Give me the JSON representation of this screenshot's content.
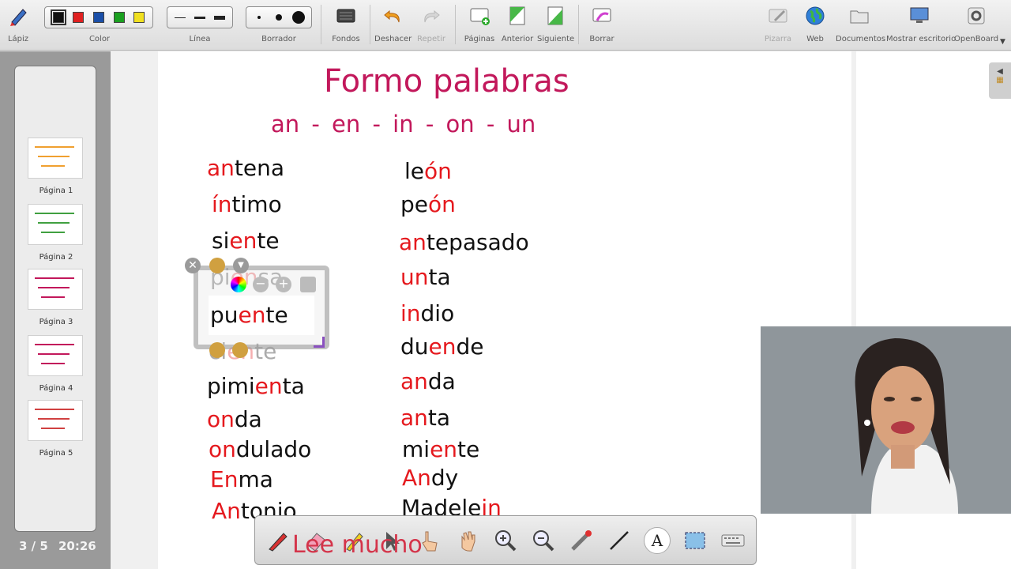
{
  "toolbar": {
    "pen_label": "Lápiz",
    "color_label": "Color",
    "line_label": "Línea",
    "eraser_label": "Borrador",
    "backgrounds_label": "Fondos",
    "undo_label": "Deshacer",
    "redo_label": "Repetir",
    "pages_label": "Páginas",
    "previous_label": "Anterior",
    "next_label": "Siguiente",
    "clear_label": "Borrar",
    "board_label": "Pizarra",
    "web_label": "Web",
    "documents_label": "Documentos",
    "desktop_label": "Mostrar escritorio",
    "app_label": "OpenBoard",
    "colors": [
      "#111111",
      "#e02020",
      "#1a4fa8",
      "#1aa020",
      "#f0e020"
    ]
  },
  "pages": {
    "thumbs": [
      {
        "label": "Página 1"
      },
      {
        "label": "Página 2"
      },
      {
        "label": "Página 3"
      },
      {
        "label": "Página 4"
      },
      {
        "label": "Página 5"
      }
    ],
    "counter": "3 / 5",
    "clock": "20:26"
  },
  "board": {
    "title": "Formo palabras",
    "syllables": "an - en - in - on  - un",
    "overlay_text": "Lee mucho",
    "left_words": [
      {
        "pre": "",
        "red": "an",
        "post": "tena"
      },
      {
        "pre": "",
        "red": "ín",
        "post": "timo"
      },
      {
        "pre": "si",
        "red": "en",
        "post": "te"
      },
      {
        "pre": "pi",
        "red": "en",
        "post": "sa"
      },
      {
        "pre": "pu",
        "red": "en",
        "post": "te"
      },
      {
        "pre": "ci",
        "red": "en",
        "post": "te"
      },
      {
        "pre": "pimi",
        "red": "en",
        "post": "ta"
      },
      {
        "pre": "",
        "red": "on",
        "post": "da"
      },
      {
        "pre": "",
        "red": "on",
        "post": "dulado"
      },
      {
        "pre": "",
        "red": "En",
        "post": "ma"
      },
      {
        "pre": "",
        "red": "An",
        "post": "tonio"
      }
    ],
    "right_words": [
      {
        "pre": "le",
        "red": "ón",
        "post": ""
      },
      {
        "pre": "pe",
        "red": "ón",
        "post": ""
      },
      {
        "pre": "",
        "red": "an",
        "post": "tepasado"
      },
      {
        "pre": "",
        "red": "un",
        "post": "ta"
      },
      {
        "pre": "",
        "red": "in",
        "post": "dio"
      },
      {
        "pre": "du",
        "red": "en",
        "post": "de"
      },
      {
        "pre": "",
        "red": "an",
        "post": "da"
      },
      {
        "pre": "",
        "red": "an",
        "post": "ta"
      },
      {
        "pre": "mi",
        "red": "en",
        "post": "te"
      },
      {
        "pre": "",
        "red": "An",
        "post": "dy"
      },
      {
        "pre": "Madele",
        "red": "in",
        "post": ""
      }
    ]
  },
  "accent": {
    "title_color": "#c2185b",
    "highlight_color": "#e5191e"
  }
}
